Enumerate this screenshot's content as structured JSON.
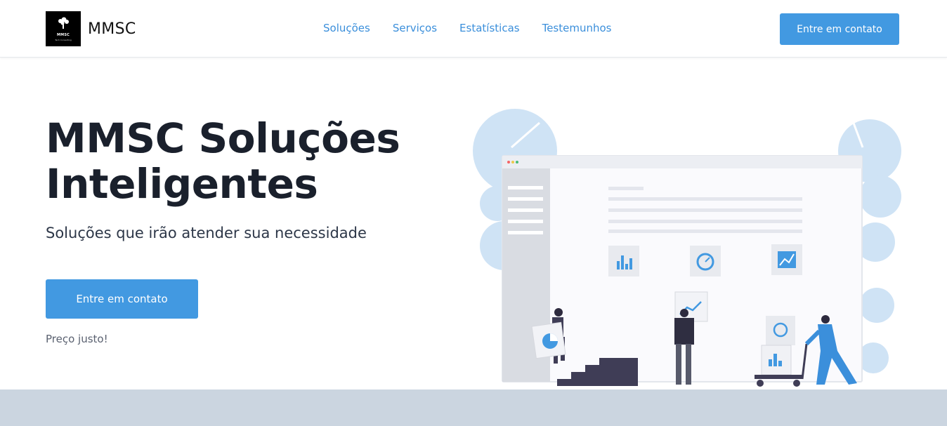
{
  "header": {
    "logo": {
      "icon": "tree-logo-icon",
      "title": "MMSC",
      "subtitle": "Tech Consulting"
    },
    "brand_name": "MMSC",
    "nav": [
      "Soluções",
      "Serviços",
      "Estatísticas",
      "Testemunhos"
    ],
    "cta_label": "Entre em contato"
  },
  "hero": {
    "title_line1": "MMSC Soluções",
    "title_line2": "Inteligentes",
    "subtitle": "Soluções que irão atender sua necessidade",
    "cta_label": "Entre em contato",
    "note": "Preço justo!"
  },
  "colors": {
    "accent": "#4299e1",
    "nav_link": "#3b8fdb",
    "heading": "#1a202c",
    "footer_band": "#cbd5e0",
    "illustration_blue": "#cfe3f5"
  }
}
